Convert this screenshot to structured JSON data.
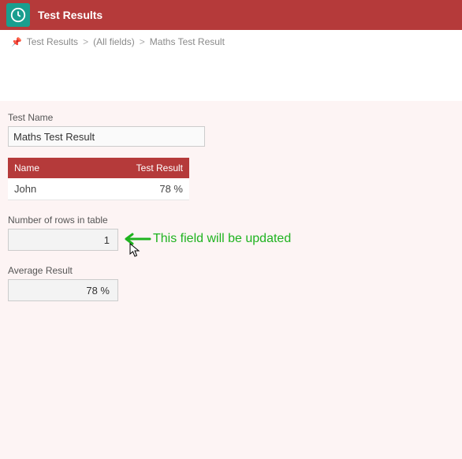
{
  "header": {
    "title": "Test Results",
    "icon": "clock-icon"
  },
  "breadcrumb": {
    "items": [
      "Test Results",
      "(All fields)",
      "Maths Test Result"
    ]
  },
  "form": {
    "test_name_label": "Test Name",
    "test_name_value": "Maths Test Result",
    "num_rows_label": "Number of rows in table",
    "num_rows_value": "1",
    "avg_result_label": "Average Result",
    "avg_result_value": "78 %"
  },
  "table": {
    "headers": [
      "Name",
      "Test Result"
    ],
    "rows": [
      {
        "name": "John",
        "result": "78 %"
      }
    ]
  },
  "annotation": {
    "text": "This field will be updated"
  }
}
